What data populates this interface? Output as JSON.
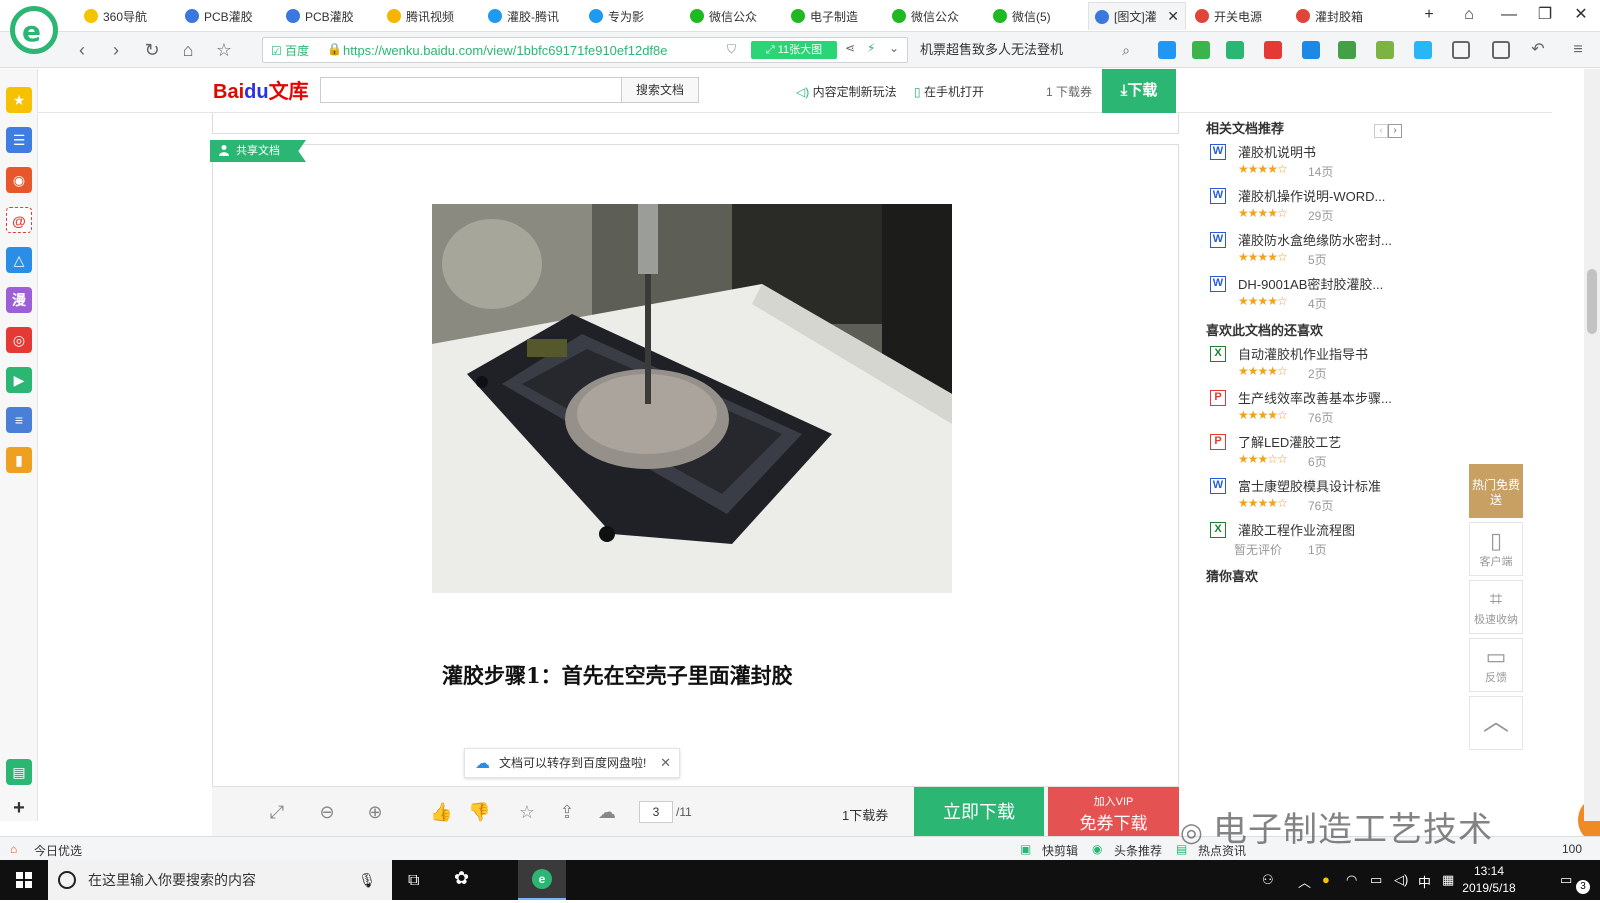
{
  "browser": {
    "tabs": [
      {
        "label": "360导航",
        "color": "#f5c400",
        "active": false
      },
      {
        "label": "PCB灌胶",
        "color": "#3a78e0",
        "active": false
      },
      {
        "label": "PCB灌胶",
        "color": "#3a78e0",
        "active": false
      },
      {
        "label": "腾讯视频",
        "color": "#f7b500",
        "active": false
      },
      {
        "label": "灌胶-腾讯",
        "color": "#1e9bf0",
        "active": false
      },
      {
        "label": "专为影",
        "color": "#1e9bf0",
        "active": false
      },
      {
        "label": "微信公众",
        "color": "#1fb922",
        "active": false
      },
      {
        "label": "电子制造",
        "color": "#1fb922",
        "active": false
      },
      {
        "label": "微信公众",
        "color": "#1fb922",
        "active": false
      },
      {
        "label": "微信(5)",
        "color": "#1fb922",
        "active": false
      },
      {
        "label": "[图文]灌",
        "color": "#3a78e0",
        "active": true
      },
      {
        "label": "开关电源",
        "color": "#e0453a",
        "active": false
      },
      {
        "label": "灌封胶箱",
        "color": "#e0453a",
        "active": false
      }
    ],
    "url_cert": "百度",
    "url": "https://wenku.baidu.com/view/1bbfc69171fe910ef12df8e",
    "bigpic_label": "11张大图",
    "search_text": "机票超售致多人无法登机"
  },
  "wenku": {
    "logo_bai": "Bai",
    "logo_du": "du",
    "logo_wenku": "文库",
    "search_placeholder": "",
    "search_button": "搜索文档",
    "custom_link": "内容定制新玩法",
    "mobile_link": "在手机打开",
    "coupon": "1 下载券",
    "download": "下载"
  },
  "document": {
    "share_tag": "共享文档",
    "caption": "灌胶步骤1：首先在空壳子里面灌封胶",
    "save_tip": "文档可以转存到百度网盘啦!",
    "page_current": "3",
    "page_total": "/11",
    "toolbar_coupon": "1下载券",
    "download_now": "立即下载",
    "vip_line1": "加入VIP",
    "vip_line2": "免券下载"
  },
  "related": {
    "title": "相关文档推荐",
    "items": [
      {
        "type": "W",
        "name": "灌胶机说明书",
        "stars": "★★★★☆",
        "pages": "14页"
      },
      {
        "type": "W",
        "name": "灌胶机操作说明-WORD...",
        "stars": "★★★★☆",
        "pages": "29页"
      },
      {
        "type": "W",
        "name": "灌胶防水盒绝缘防水密封...",
        "stars": "★★★★☆",
        "pages": "5页"
      },
      {
        "type": "W",
        "name": "DH-9001AB密封胶灌胶...",
        "stars": "★★★★☆",
        "pages": "4页"
      }
    ]
  },
  "also_like": {
    "title": "喜欢此文档的还喜欢",
    "items": [
      {
        "type": "X",
        "name": "自动灌胶机作业指导书",
        "stars": "★★★★☆",
        "pages": "2页"
      },
      {
        "type": "P",
        "name": "生产线效率改善基本步骤...",
        "stars": "★★★★☆",
        "pages": "76页"
      },
      {
        "type": "P",
        "name": "了解LED灌胶工艺",
        "stars": "★★★☆☆",
        "pages": "6页"
      },
      {
        "type": "W",
        "name": "富士康塑胶模具设计标准",
        "stars": "★★★★☆",
        "pages": "76页"
      },
      {
        "type": "X",
        "name": "灌胶工程作业流程图",
        "norate": "暂无评价",
        "pages": "1页"
      }
    ]
  },
  "guess_title": "猜你喜欢",
  "side_tools": {
    "hot_free": "热门免费送",
    "client": "客户端",
    "collect": "极速收纳",
    "feedback": "反馈"
  },
  "statusbar": {
    "today": "今日优选",
    "quick_clip": "快剪辑",
    "headline": "头条推荐",
    "hot_info": "热点资讯",
    "zoom": "100"
  },
  "watermark": "电子制造工艺技术",
  "taskbar": {
    "search_placeholder": "在这里输入你要搜索的内容",
    "time": "13:14",
    "date": "2019/5/18",
    "ime": "中",
    "notif_count": "3"
  }
}
